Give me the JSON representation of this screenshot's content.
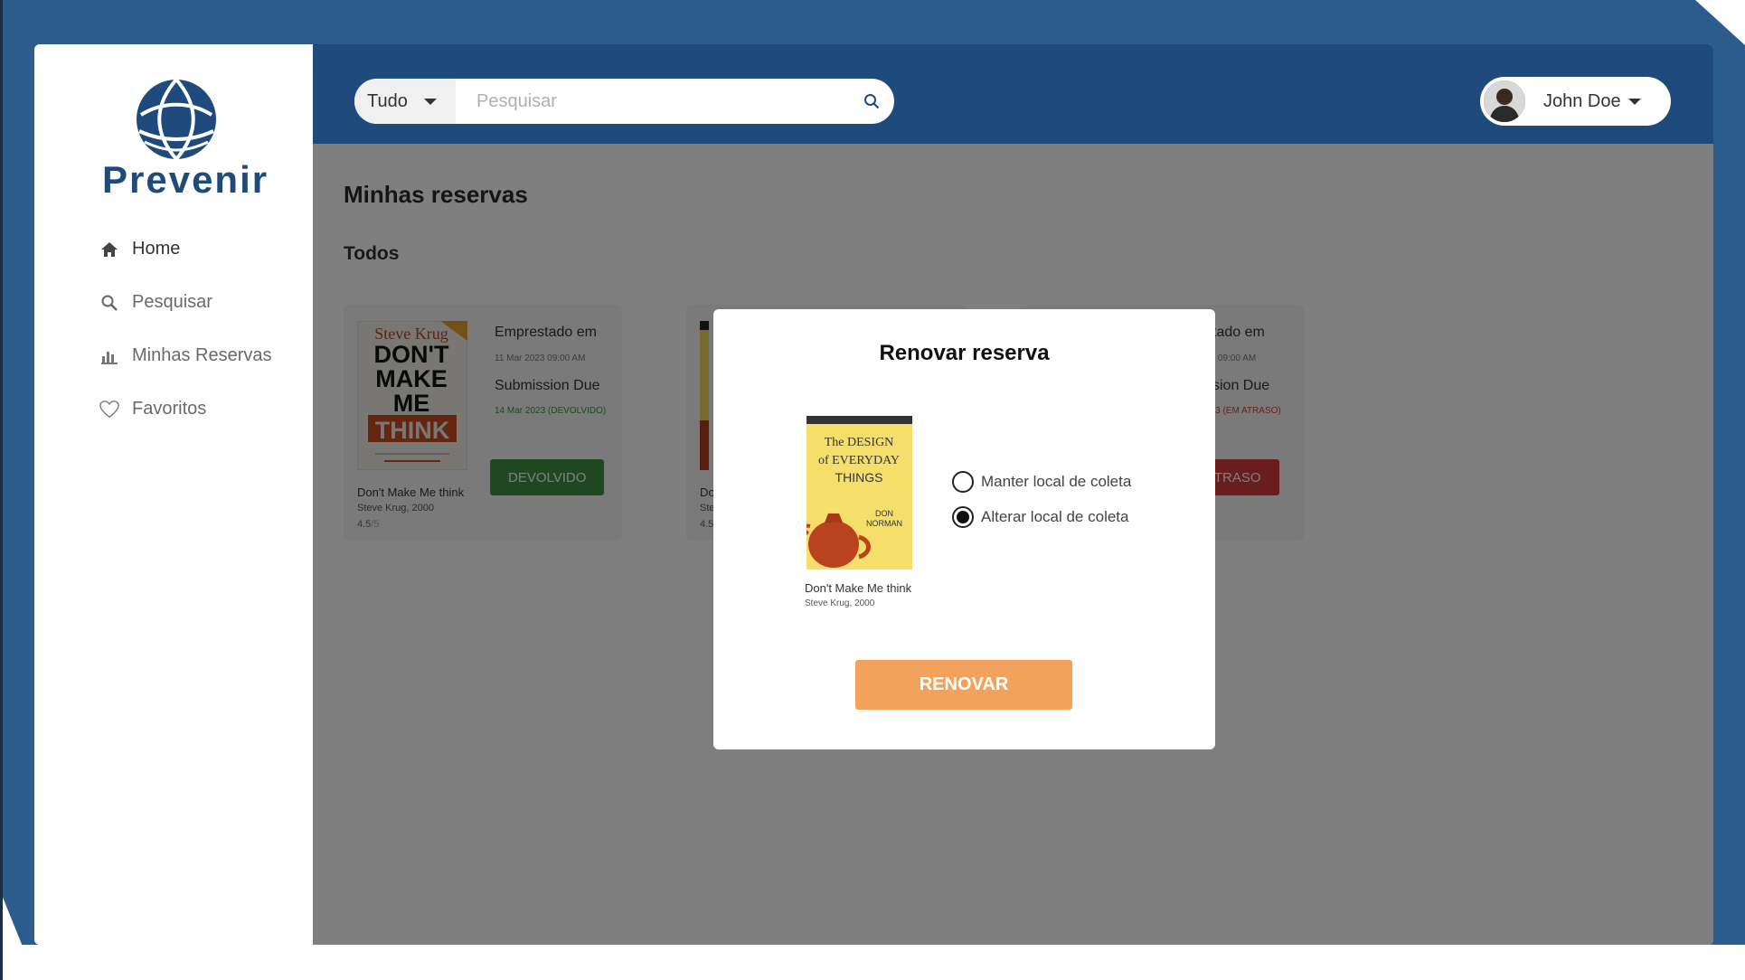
{
  "app": {
    "brand": "Prevenir"
  },
  "sidebar": {
    "items": [
      {
        "label": "Home",
        "icon": "home-icon",
        "active": true
      },
      {
        "label": "Pesquisar",
        "icon": "search-icon",
        "active": false
      },
      {
        "label": "Minhas Reservas",
        "icon": "chart-bar-icon",
        "active": false
      },
      {
        "label": "Favoritos",
        "icon": "heart-icon",
        "active": false
      }
    ]
  },
  "header": {
    "search_scope": "Tudo",
    "search_placeholder": "Pesquisar",
    "user_name": "John Doe"
  },
  "main": {
    "page_title": "Minhas reservas",
    "section_title": "Todos",
    "cards": [
      {
        "title": "Don't Make Me think",
        "meta": "Steve Krug, 2000",
        "rating": "4.5",
        "rating_denominator": "/5",
        "borrowed_label": "Emprestado em",
        "borrowed_value": "11 Mar 2023 09:00 AM",
        "due_label": "Submission Due",
        "due_value": "14 Mar 2023 (DEVOLVIDO)",
        "status_label": "DEVOLVIDO",
        "status_color": "#3f9142",
        "due_color": "#3f9142",
        "cover_title_lines": [
          "Steve Krug",
          "DON'T",
          "MAKE",
          "ME",
          "THINK"
        ]
      },
      {
        "title_partial": "Do",
        "meta_partial": "Ste",
        "rating_partial": "4.5"
      },
      {
        "borrowed_label_partial": "stado em",
        "borrowed_value_partial": "23 09:00 AM",
        "due_label_partial": "ssion Due",
        "due_value_partial": "023 (EM ATRASO)",
        "status_label_partial": "ATRASO",
        "status_color": "#d23b3b",
        "due_color": "#d23b3b"
      }
    ]
  },
  "modal": {
    "title": "Renovar reserva",
    "book_title": "Don't Make Me think",
    "book_meta": "Steve Krug, 2000",
    "cover_lines": [
      "The DESIGN",
      "of EVERYDAY",
      "THINGS",
      "DON",
      "NORMAN"
    ],
    "options": [
      {
        "label": "Manter local de coleta",
        "selected": false
      },
      {
        "label": "Alterar local de coleta",
        "selected": true
      }
    ],
    "submit_label": "RENOVAR",
    "accent_color": "#f2a25c"
  }
}
